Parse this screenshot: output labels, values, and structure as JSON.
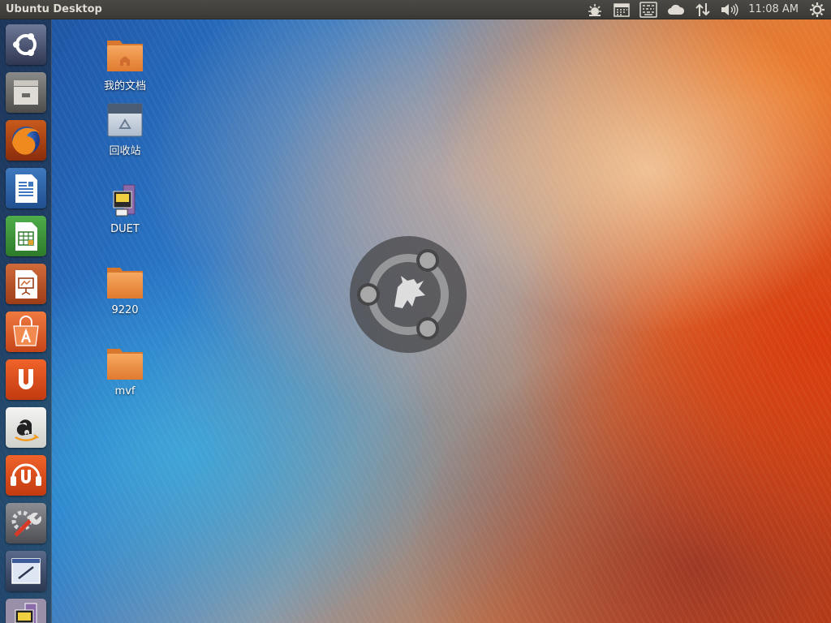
{
  "panel": {
    "title": "Ubuntu Desktop",
    "clock": "11:08 AM",
    "indicators": [
      "weather-icon",
      "calendar-icon",
      "keyboard-icon",
      "cloud-icon",
      "network-icon",
      "volume-icon",
      "session-gear-icon"
    ]
  },
  "launcher": {
    "items": [
      {
        "name": "dash-home",
        "icon": "ubuntu-logo-icon"
      },
      {
        "name": "files",
        "icon": "file-cabinet-icon"
      },
      {
        "name": "firefox",
        "icon": "firefox-icon"
      },
      {
        "name": "libreoffice-writer",
        "icon": "writer-icon"
      },
      {
        "name": "libreoffice-calc",
        "icon": "calc-icon"
      },
      {
        "name": "libreoffice-impress",
        "icon": "impress-icon"
      },
      {
        "name": "software-center",
        "icon": "shopping-bag-icon"
      },
      {
        "name": "ubuntu-one",
        "icon": "ubuntu-one-icon"
      },
      {
        "name": "amazon",
        "icon": "amazon-icon"
      },
      {
        "name": "ubuntu-one-music",
        "icon": "ubuntu-one-music-icon"
      },
      {
        "name": "system-settings",
        "icon": "settings-wrench-icon"
      },
      {
        "name": "workspace-switcher",
        "icon": "workspace-icon"
      },
      {
        "name": "duet-device",
        "icon": "device-icon"
      }
    ]
  },
  "desktop": {
    "icons": [
      {
        "label": "我的文档",
        "icon": "home-folder-icon"
      },
      {
        "label": "回收站",
        "icon": "trash-icon"
      },
      {
        "label": "DUET",
        "icon": "device-icon"
      },
      {
        "label": "9220",
        "icon": "folder-icon"
      },
      {
        "label": "mvf",
        "icon": "folder-icon"
      }
    ]
  },
  "colors": {
    "panel_bg": "#3c3b37",
    "panel_text": "#dfdbd2",
    "folder_orange": "#f2954a",
    "accent_orange": "#e95420"
  }
}
